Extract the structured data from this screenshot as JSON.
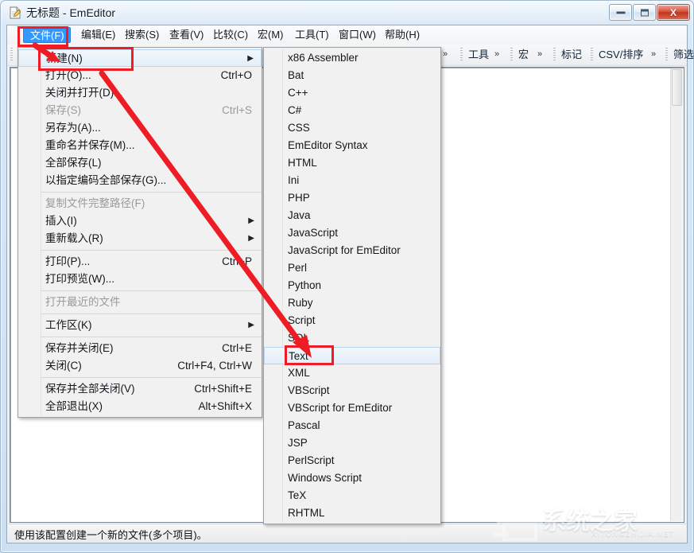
{
  "window": {
    "title": "无标题 - EmEditor",
    "icon": "emeditor-document-icon",
    "buttons": {
      "minimize": "minimize-icon",
      "maximize": "maximize-icon",
      "close": "X"
    }
  },
  "menubar": {
    "items": [
      {
        "label": "文件(F)",
        "active": true
      },
      {
        "label": "编辑(E)",
        "active": false
      },
      {
        "label": "搜索(S)",
        "active": false
      },
      {
        "label": "查看(V)",
        "active": false
      },
      {
        "label": "比较(C)",
        "active": false
      },
      {
        "label": "宏(M)",
        "active": false
      },
      {
        "label": "工具(T)",
        "active": false
      },
      {
        "label": "窗口(W)",
        "active": false
      },
      {
        "label": "帮助(H)",
        "active": false
      }
    ]
  },
  "toolbar": {
    "chunks": [
      {
        "label": "",
        "chevron": "»"
      },
      {
        "label": "工具",
        "chevron": "»"
      },
      {
        "label": "宏",
        "chevron": "»"
      },
      {
        "label": "标记",
        "chevron": ""
      },
      {
        "label": "CSV/排序",
        "chevron": "»"
      },
      {
        "label": "筛选",
        "chevron": "»"
      }
    ]
  },
  "file_menu": {
    "items": [
      {
        "label": "新建(N)",
        "accel": "",
        "submenu": true,
        "disabled": false,
        "highlight": true,
        "separator_after": false
      },
      {
        "label": "打开(O)...",
        "accel": "Ctrl+O",
        "submenu": false,
        "disabled": false,
        "highlight": false,
        "separator_after": false
      },
      {
        "label": "关闭并打开(D)...",
        "accel": "",
        "submenu": false,
        "disabled": false,
        "highlight": false,
        "separator_after": false
      },
      {
        "label": "保存(S)",
        "accel": "Ctrl+S",
        "submenu": false,
        "disabled": true,
        "highlight": false,
        "separator_after": false
      },
      {
        "label": "另存为(A)...",
        "accel": "",
        "submenu": false,
        "disabled": false,
        "highlight": false,
        "separator_after": false
      },
      {
        "label": "重命名并保存(M)...",
        "accel": "",
        "submenu": false,
        "disabled": false,
        "highlight": false,
        "separator_after": false
      },
      {
        "label": "全部保存(L)",
        "accel": "",
        "submenu": false,
        "disabled": false,
        "highlight": false,
        "separator_after": false
      },
      {
        "label": "以指定编码全部保存(G)...",
        "accel": "",
        "submenu": false,
        "disabled": false,
        "highlight": false,
        "separator_after": true
      },
      {
        "label": "复制文件完整路径(F)",
        "accel": "",
        "submenu": false,
        "disabled": true,
        "highlight": false,
        "separator_after": false
      },
      {
        "label": "插入(I)",
        "accel": "",
        "submenu": true,
        "disabled": false,
        "highlight": false,
        "separator_after": false
      },
      {
        "label": "重新载入(R)",
        "accel": "",
        "submenu": true,
        "disabled": false,
        "highlight": false,
        "separator_after": true
      },
      {
        "label": "打印(P)...",
        "accel": "Ctrl+P",
        "submenu": false,
        "disabled": false,
        "highlight": false,
        "separator_after": false
      },
      {
        "label": "打印预览(W)...",
        "accel": "",
        "submenu": false,
        "disabled": false,
        "highlight": false,
        "separator_after": true
      },
      {
        "label": "打开最近的文件",
        "accel": "",
        "submenu": false,
        "disabled": true,
        "highlight": false,
        "separator_after": true
      },
      {
        "label": "工作区(K)",
        "accel": "",
        "submenu": true,
        "disabled": false,
        "highlight": false,
        "separator_after": true
      },
      {
        "label": "保存并关闭(E)",
        "accel": "Ctrl+E",
        "submenu": false,
        "disabled": false,
        "highlight": false,
        "separator_after": false
      },
      {
        "label": "关闭(C)",
        "accel": "Ctrl+F4, Ctrl+W",
        "submenu": false,
        "disabled": false,
        "highlight": false,
        "separator_after": true
      },
      {
        "label": "保存并全部关闭(V)",
        "accel": "Ctrl+Shift+E",
        "submenu": false,
        "disabled": false,
        "highlight": false,
        "separator_after": false
      },
      {
        "label": "全部退出(X)",
        "accel": "Alt+Shift+X",
        "submenu": false,
        "disabled": false,
        "highlight": false,
        "separator_after": false
      }
    ]
  },
  "new_submenu": {
    "items": [
      {
        "label": "x86 Assembler",
        "highlight": false
      },
      {
        "label": "Bat",
        "highlight": false
      },
      {
        "label": "C++",
        "highlight": false
      },
      {
        "label": "C#",
        "highlight": false
      },
      {
        "label": "CSS",
        "highlight": false
      },
      {
        "label": "EmEditor Syntax",
        "highlight": false
      },
      {
        "label": "HTML",
        "highlight": false
      },
      {
        "label": "Ini",
        "highlight": false
      },
      {
        "label": "PHP",
        "highlight": false
      },
      {
        "label": "Java",
        "highlight": false
      },
      {
        "label": "JavaScript",
        "highlight": false
      },
      {
        "label": "JavaScript for EmEditor",
        "highlight": false
      },
      {
        "label": "Perl",
        "highlight": false
      },
      {
        "label": "Python",
        "highlight": false
      },
      {
        "label": "Ruby",
        "highlight": false
      },
      {
        "label": "Script",
        "highlight": false
      },
      {
        "label": "SQL",
        "highlight": false
      },
      {
        "label": "Text",
        "highlight": true
      },
      {
        "label": "XML",
        "highlight": false
      },
      {
        "label": "VBScript",
        "highlight": false
      },
      {
        "label": "VBScript for EmEditor",
        "highlight": false
      },
      {
        "label": "Pascal",
        "highlight": false
      },
      {
        "label": "JSP",
        "highlight": false
      },
      {
        "label": "PerlScript",
        "highlight": false
      },
      {
        "label": "Windows Script",
        "highlight": false
      },
      {
        "label": "TeX",
        "highlight": false
      },
      {
        "label": "RHTML",
        "highlight": false
      }
    ]
  },
  "statusbar": {
    "text": "使用该配置创建一个新的文件(多个项目)。"
  },
  "annotations": {
    "color": "#ee1c25",
    "boxes": [
      "file-menu-button",
      "new-item",
      "text-item"
    ],
    "arrows": [
      "arrow-to-new",
      "arrow-to-text"
    ]
  },
  "watermark": {
    "text": "系统之家",
    "subtext": "XITONGZHIJIA.NET"
  }
}
